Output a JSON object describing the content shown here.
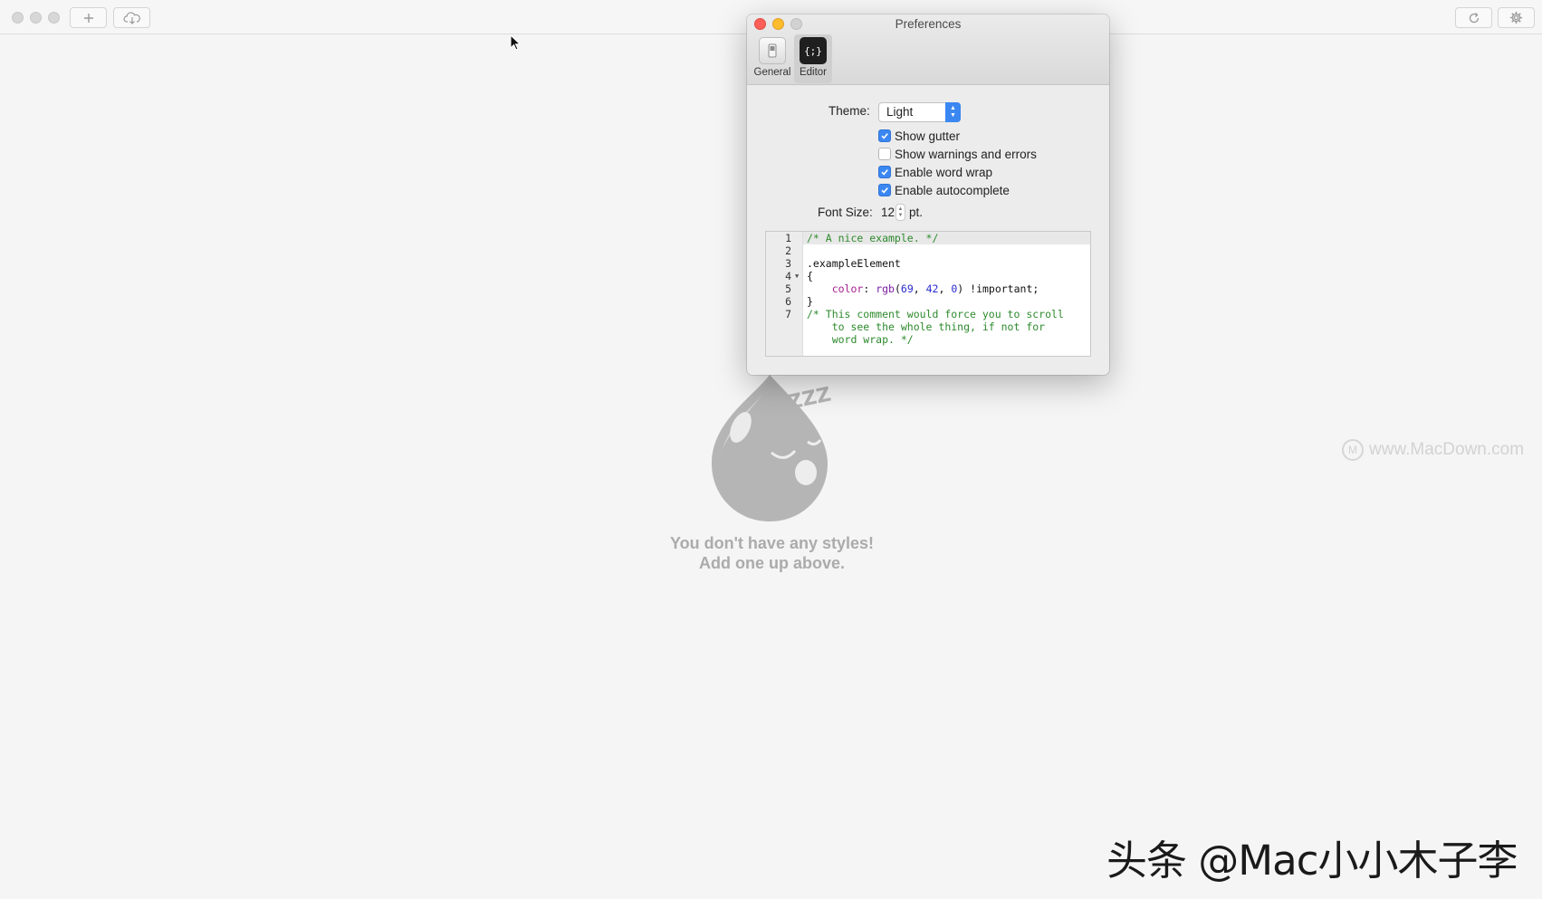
{
  "main_window": {
    "toolbar": {
      "add_icon": "plus-icon",
      "cloud_icon": "cloud-download-icon",
      "refresh_icon": "refresh-icon",
      "settings_icon": "gear-icon"
    },
    "empty_state": {
      "mascot_icon": "sleeping-drop-mascot",
      "zzz": "ZZZ",
      "line1": "You don't have any styles!",
      "line2": "Add one up above."
    }
  },
  "preferences": {
    "title": "Preferences",
    "tabs": [
      {
        "label": "General",
        "icon": "switch-icon",
        "active": false
      },
      {
        "label": "Editor",
        "icon": "code-braces-icon",
        "icon_text": "{;}",
        "active": true
      }
    ],
    "theme": {
      "label": "Theme:",
      "value": "Light"
    },
    "checkboxes": [
      {
        "label": "Show gutter",
        "checked": true
      },
      {
        "label": "Show warnings and errors",
        "checked": false
      },
      {
        "label": "Enable word wrap",
        "checked": true
      },
      {
        "label": "Enable autocomplete",
        "checked": true
      }
    ],
    "font_size": {
      "label": "Font Size:",
      "value": "12",
      "unit": "pt."
    },
    "code_preview": {
      "line_numbers": [
        "1",
        "2",
        "3",
        "4",
        "5",
        "6",
        "7"
      ],
      "lines": [
        "/* A nice example. */",
        "",
        ".exampleElement",
        "{",
        "    color: rgb(69, 42, 0) !important;",
        "}",
        "/* This comment would force you to scroll",
        "    to see the whole thing, if not for",
        "    word wrap. */"
      ]
    }
  },
  "watermarks": {
    "url": "www.MacDown.com",
    "url_icon_text": "M",
    "cn": "头条 @Mac小小木子李"
  },
  "colors": {
    "accent_blue": "#3b87f2",
    "comment_green": "#2d8a2d",
    "close_red": "#fc5f57",
    "minimize_yellow": "#fdbc2e"
  }
}
